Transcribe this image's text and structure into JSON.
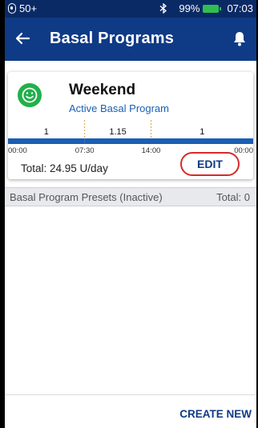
{
  "status_bar": {
    "pod_indicator": "50+",
    "bluetooth_icon": "bluetooth-icon",
    "battery_percent": "99%",
    "battery_color": "#2fbf4f",
    "time": "07:03"
  },
  "app_bar": {
    "title": "Basal Programs",
    "back_icon": "arrow-left-icon",
    "notification_icon": "bell-icon",
    "color": "#0f3a86"
  },
  "program_card": {
    "name": "Weekend",
    "status": "Active Basal Program",
    "icon": "smiley-icon",
    "icon_color": "#22b04b",
    "total_label": "Total: 24.95 U/day",
    "edit_label": "EDIT"
  },
  "chart_data": {
    "type": "bar",
    "segments": [
      {
        "start": "00:00",
        "end": "07:30",
        "rate": "1"
      },
      {
        "start": "07:30",
        "end": "14:00",
        "rate": "1.15"
      },
      {
        "start": "14:00",
        "end": "24:00",
        "rate": "1"
      }
    ],
    "x_ticks": [
      "00:00",
      "07:30",
      "14:00",
      "00:00"
    ],
    "bar_color": "#1a5fb4"
  },
  "presets": {
    "label": "Basal Program Presets (Inactive)",
    "total": "Total: 0"
  },
  "footer": {
    "create_new_label": "CREATE NEW"
  }
}
